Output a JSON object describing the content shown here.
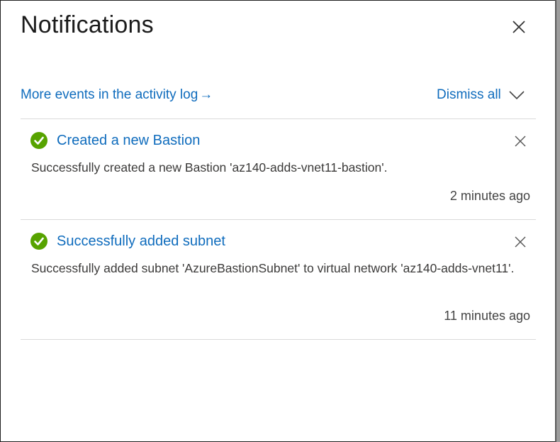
{
  "panel": {
    "title": "Notifications",
    "close_icon": "close-icon"
  },
  "toolbar": {
    "activity_link": "More events in the activity log",
    "activity_arrow": "→",
    "dismiss_all": "Dismiss all"
  },
  "colors": {
    "link": "#0f6cbd",
    "success": "#57a300",
    "divider": "#dadada"
  },
  "notifications": [
    {
      "status": "success",
      "icon": "success-check-icon",
      "title": "Created a new Bastion",
      "message": "Successfully created a new Bastion 'az140-adds-vnet11-bastion'.",
      "time": "2 minutes ago"
    },
    {
      "status": "success",
      "icon": "success-check-icon",
      "title": "Successfully added subnet",
      "message": "Successfully added subnet 'AzureBastionSubnet' to virtual network 'az140-adds-vnet11'.",
      "time": "11 minutes ago"
    }
  ]
}
